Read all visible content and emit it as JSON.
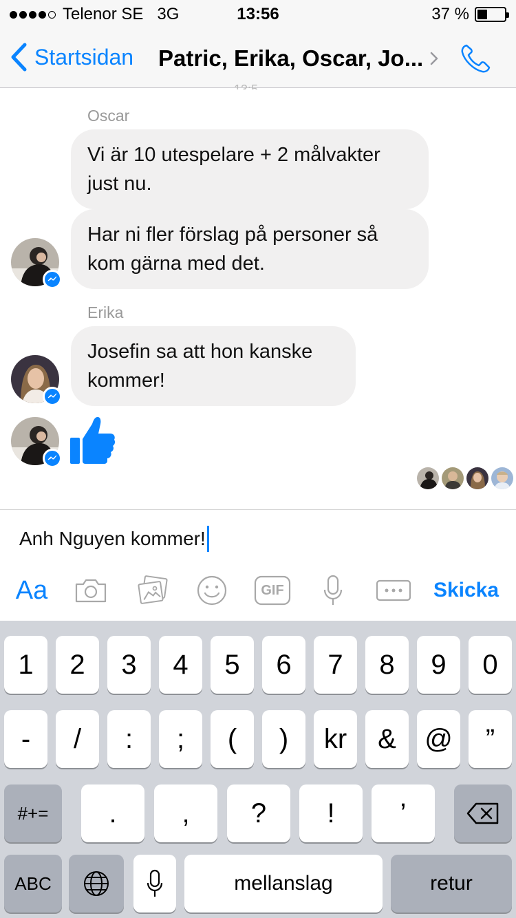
{
  "status_bar": {
    "carrier": "Telenor SE",
    "network": "3G",
    "time": "13:56",
    "battery_percent": "37 %",
    "battery_level": 0.37,
    "signal_bars_filled": 4,
    "signal_bars_total": 5
  },
  "nav": {
    "back_label": "Startsidan",
    "title": "Patric, Erika, Oscar, Jo...",
    "back_icon": "chevron-left-icon",
    "call_icon": "phone-icon"
  },
  "conversation": {
    "groups": [
      {
        "sender": "Oscar",
        "messages": [
          "Vi är 10 utespelare + 2 målvakter just nu.",
          "Har ni fler förslag på personer så kom gärna med det."
        ]
      },
      {
        "sender": "Erika",
        "messages": [
          "Josefin sa att hon kanske kommer!"
        ]
      }
    ],
    "like_sticker": "thumbs-up-icon"
  },
  "composer": {
    "text": "Anh Nguyen kommer!",
    "aa_label": "Aa",
    "send_label": "Skicka",
    "gif_label": "GIF"
  },
  "keyboard": {
    "row1": [
      "1",
      "2",
      "3",
      "4",
      "5",
      "6",
      "7",
      "8",
      "9",
      "0"
    ],
    "row2": [
      "-",
      "/",
      ":",
      ";",
      "(",
      ")",
      "kr",
      "&",
      "@",
      "”"
    ],
    "row3": {
      "mode_key": "#+=",
      "keys": [
        ".",
        ",",
        "?",
        "!",
        "’"
      ]
    },
    "row4": {
      "abc_key": "ABC",
      "space_label": "mellanslag",
      "return_label": "retur"
    }
  },
  "colors": {
    "accent": "#0a84ff",
    "bubble": "#f1f0f0",
    "keyboard_bg": "#d1d4da"
  }
}
